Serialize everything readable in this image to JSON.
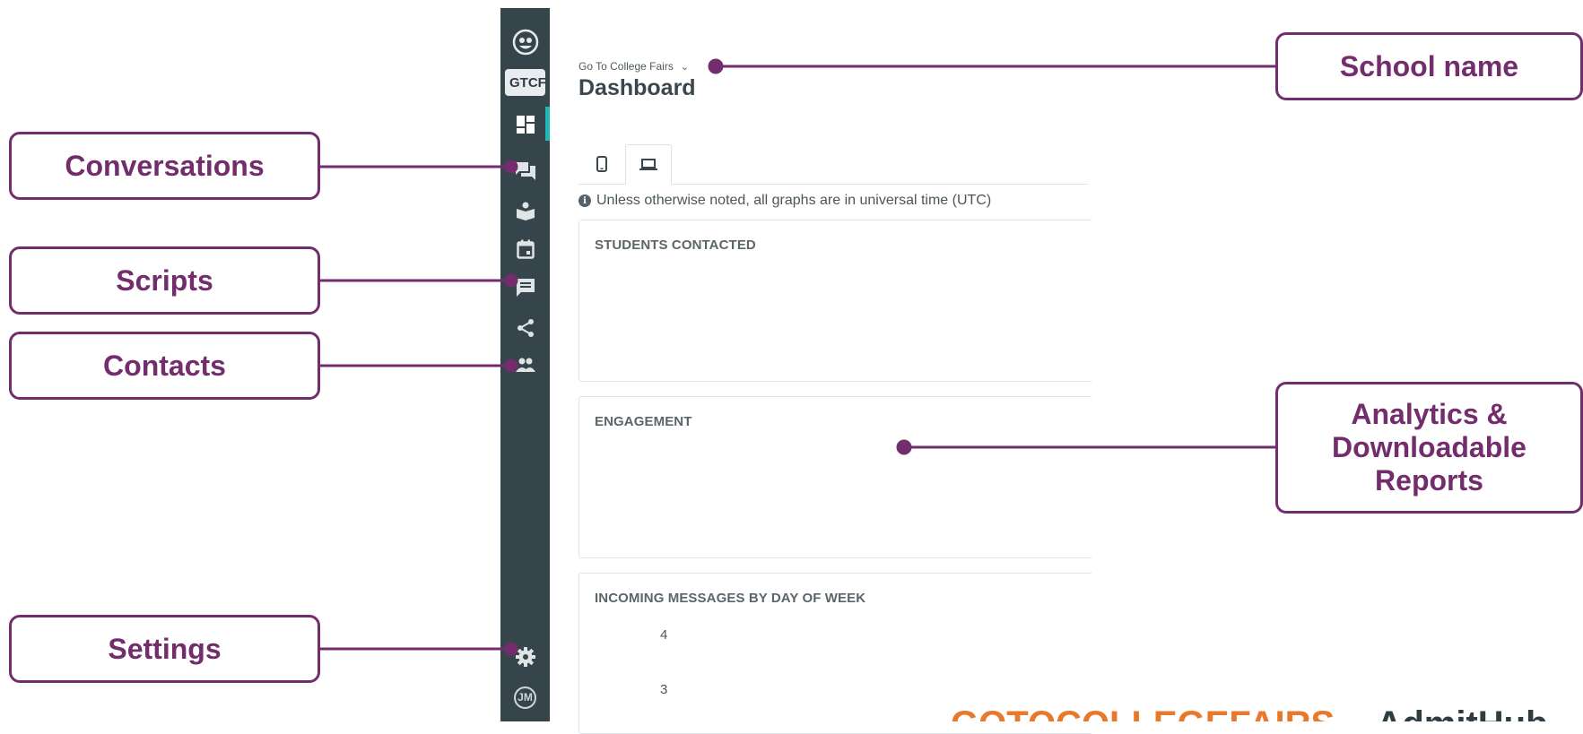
{
  "sidebar": {
    "badge_text": "GTCF",
    "user_initials": "JM",
    "items": [
      {
        "icon": "owl-logo-icon"
      },
      {
        "icon": "dashboard-icon"
      },
      {
        "icon": "conversations-icon"
      },
      {
        "icon": "knowledge-base-icon"
      },
      {
        "icon": "calendar-icon"
      },
      {
        "icon": "scripts-icon"
      },
      {
        "icon": "share-integrations-icon"
      },
      {
        "icon": "contacts-icon"
      },
      {
        "icon": "gear-icon"
      }
    ]
  },
  "header": {
    "school_name": "Go To College Fairs",
    "page_title": "Dashboard"
  },
  "tabs": [
    {
      "icon": "mobile-icon",
      "active": false
    },
    {
      "icon": "desktop-icon",
      "active": true
    }
  ],
  "note": "Unless otherwise noted, all graphs are in universal time (UTC)",
  "cards": [
    {
      "title": "STUDENTS CONTACTED"
    },
    {
      "title": "ENGAGEMENT"
    },
    {
      "title": "INCOMING MESSAGES BY DAY OF WEEK",
      "y_ticks": [
        "4",
        "3"
      ]
    }
  ],
  "callouts": {
    "conversations": "Conversations",
    "scripts": "Scripts",
    "contacts": "Contacts",
    "settings": "Settings",
    "school_name": "School name",
    "analytics": "Analytics & Downloadable Reports"
  },
  "logo": {
    "left": "GOTOCOLLEGEFAIRS",
    "right": "AdmitHub"
  },
  "colors": {
    "sidebar_bg": "#36454b",
    "accent": "#1fb9b3",
    "callout": "#742d6c"
  }
}
